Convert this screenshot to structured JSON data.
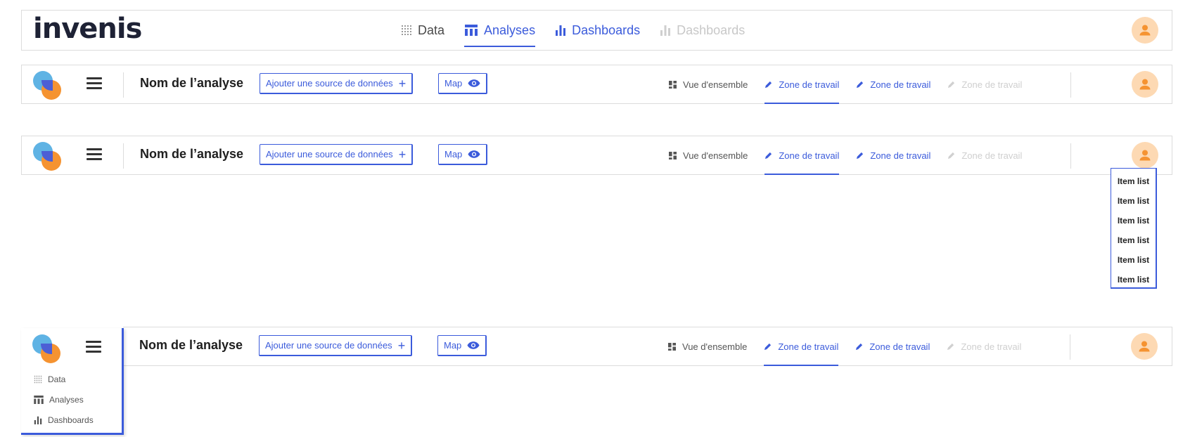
{
  "brand": {
    "logo_text": "invenis"
  },
  "topnav": {
    "items": [
      {
        "label": "Data",
        "icon": "grid-dots-icon",
        "state": "normal"
      },
      {
        "label": "Analyses",
        "icon": "table-icon",
        "state": "active"
      },
      {
        "label": "Dashboards",
        "icon": "bar-chart-icon",
        "state": "link"
      },
      {
        "label": "Dashboards",
        "icon": "bar-chart-icon",
        "state": "disabled"
      }
    ]
  },
  "analysis_bar": {
    "name": "Nom de l’analyse",
    "add_source_label": "Ajouter une source de données",
    "map_label": "Map",
    "tabs": [
      {
        "label": "Vue d'ensemble",
        "icon": "grid-icon",
        "state": "normal"
      },
      {
        "label": "Zone de travail",
        "icon": "pencil-icon",
        "state": "active"
      },
      {
        "label": "Zone de travail",
        "icon": "pencil-icon",
        "state": "link"
      },
      {
        "label": "Zone de travail",
        "icon": "pencil-icon",
        "state": "disabled"
      }
    ]
  },
  "user_dropdown": {
    "items": [
      "Item list",
      "Item list",
      "Item list",
      "Item list",
      "Item list",
      "Item list"
    ]
  },
  "side_menu": {
    "items": [
      {
        "label": "Data",
        "icon": "grid-dots-icon"
      },
      {
        "label": "Analyses",
        "icon": "table-icon"
      },
      {
        "label": "Dashboards",
        "icon": "bar-chart-icon"
      }
    ]
  },
  "colors": {
    "accent": "#3b5bdb",
    "avatar_bg": "#fdd9b3",
    "avatar_fg": "#f59331",
    "logo_blue": "#5fb3e4",
    "logo_orange": "#f59331",
    "border": "#dcdcdc"
  }
}
